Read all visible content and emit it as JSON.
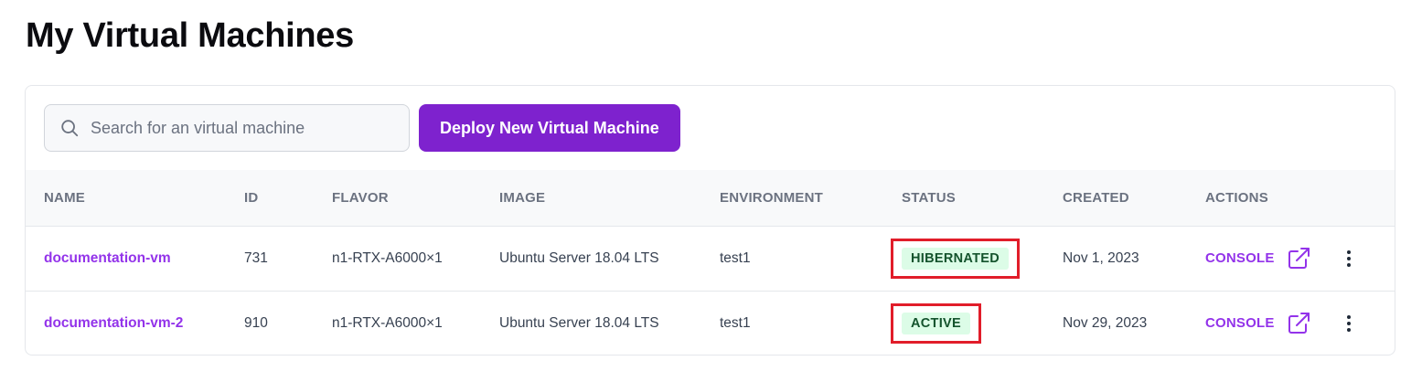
{
  "page": {
    "title": "My Virtual Machines"
  },
  "toolbar": {
    "search_placeholder": "Search for an virtual machine",
    "search_value": "",
    "deploy_label": "Deploy New Virtual Machine"
  },
  "table": {
    "headers": [
      "NAME",
      "ID",
      "FLAVOR",
      "IMAGE",
      "ENVIRONMENT",
      "STATUS",
      "CREATED",
      "ACTIONS"
    ],
    "rows": [
      {
        "name": "documentation-vm",
        "id": "731",
        "flavor": "n1-RTX-A6000×1",
        "image": "Ubuntu Server 18.04 LTS",
        "environment": "test1",
        "status": "HIBERNATED",
        "created": "Nov 1, 2023",
        "action": "CONSOLE"
      },
      {
        "name": "documentation-vm-2",
        "id": "910",
        "flavor": "n1-RTX-A6000×1",
        "image": "Ubuntu Server 18.04 LTS",
        "environment": "test1",
        "status": "ACTIVE",
        "created": "Nov 29, 2023",
        "action": "CONSOLE"
      }
    ]
  },
  "icons": {
    "search": "search-icon",
    "external": "external-link-icon",
    "more": "more-vertical-icon"
  },
  "colors": {
    "accent": "#7e22ce",
    "link": "#9333ea",
    "badge_bg": "#dcfce7",
    "badge_text": "#14532d",
    "highlight": "#e11d2a"
  }
}
